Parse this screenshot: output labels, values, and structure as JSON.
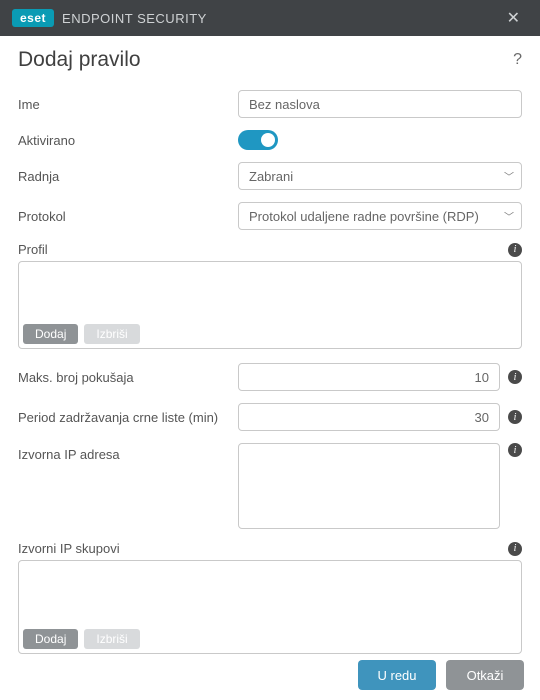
{
  "titlebar": {
    "brand_logo": "eset",
    "brand_name": "ENDPOINT SECURITY"
  },
  "header": {
    "title": "Dodaj pravilo"
  },
  "form": {
    "name_label": "Ime",
    "name_value": "Bez naslova",
    "enabled_label": "Aktivirano",
    "enabled_value": true,
    "action_label": "Radnja",
    "action_value": "Zabrani",
    "protocol_label": "Protokol",
    "protocol_value": "Protokol udaljene radne površine (RDP)",
    "profile_label": "Profil",
    "max_attempts_label": "Maks. broj pokušaja",
    "max_attempts_value": "10",
    "blacklist_period_label": "Period zadržavanja crne liste (min)",
    "blacklist_period_value": "30",
    "source_ip_label": "Izvorna IP adresa",
    "source_ip_value": "",
    "source_ip_sets_label": "Izvorni IP skupovi"
  },
  "buttons": {
    "add": "Dodaj",
    "delete": "Izbriši",
    "ok": "U redu",
    "cancel": "Otkaži"
  }
}
